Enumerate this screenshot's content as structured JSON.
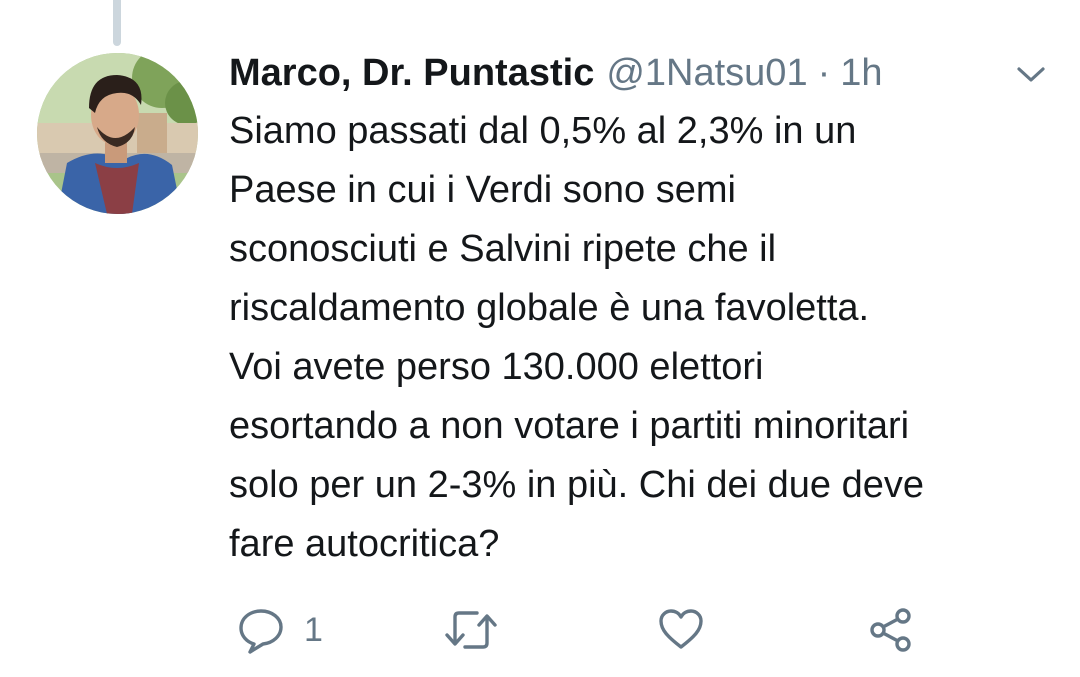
{
  "tweet": {
    "display_name": "Marco, Dr. Puntastic",
    "handle": "@1Natsu01",
    "separator": "·",
    "time_ago": "1h",
    "text": "Siamo passati dal 0,5% al 2,3% in un\nPaese in cui i Verdi sono semi\nsconosciuti e Salvini ripete che il\nriscaldamento globale è una favoletta.\nVoi avete perso 130.000 elettori\nesortando a non votare i partiti minoritari\nsolo per un 2-3% in più. Chi dei due deve\nfare autocritica?"
  },
  "actions": {
    "reply": {
      "icon": "reply-icon",
      "count": "1"
    },
    "retweet": {
      "icon": "retweet-icon"
    },
    "like": {
      "icon": "heart-icon"
    },
    "share": {
      "icon": "share-icon"
    }
  },
  "colors": {
    "text": "#14171a",
    "secondary": "#657786",
    "thread_line": "#ccd6dd",
    "background": "#ffffff"
  }
}
